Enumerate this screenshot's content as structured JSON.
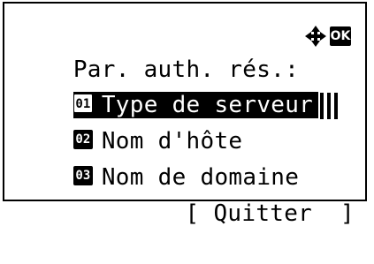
{
  "screen": {
    "title": "Par. auth. rés.:",
    "ok_label": "OK",
    "nav_icon": "four-way-arrow-icon"
  },
  "menu": {
    "items": [
      {
        "number": "01",
        "label": "Type de serveur",
        "selected": true
      },
      {
        "number": "02",
        "label": "Nom d'hôte",
        "selected": false
      },
      {
        "number": "03",
        "label": "Nom de domaine",
        "selected": false
      }
    ]
  },
  "softkey": {
    "label": "[ Quitter  ]"
  }
}
